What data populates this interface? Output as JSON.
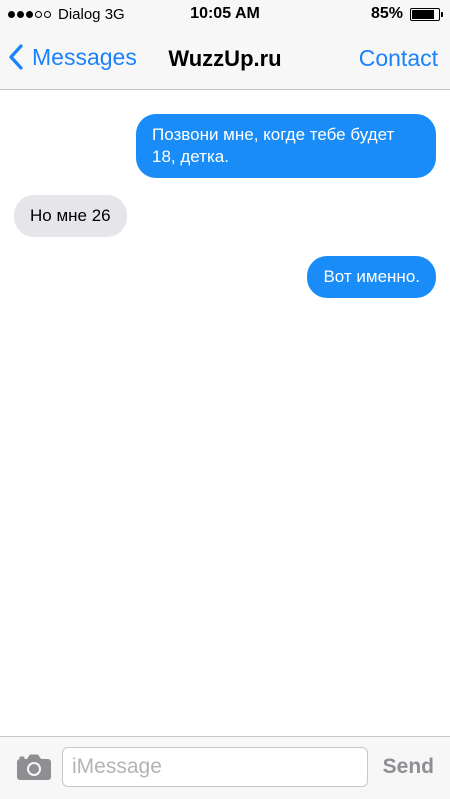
{
  "status_bar": {
    "signal_filled": 3,
    "signal_total": 5,
    "carrier": "Dialog 3G",
    "time": "10:05 AM",
    "battery_percent_label": "85%",
    "battery_level": 0.85
  },
  "nav": {
    "back_label": "Messages",
    "title": "WuzzUp.ru",
    "contact_label": "Contact",
    "accent_color": "#1a82fb"
  },
  "messages": [
    {
      "direction": "outgoing",
      "text": "Позвони мне, когде тебе будет 18, детка."
    },
    {
      "direction": "incoming",
      "text": "Но мне 26"
    },
    {
      "direction": "outgoing",
      "text": "Вот именно."
    }
  ],
  "colors": {
    "outgoing_bubble": "#1a8cf8",
    "incoming_bubble": "#e5e5ea"
  },
  "input_bar": {
    "camera_icon": "camera-icon",
    "placeholder": "iMessage",
    "value": "",
    "send_label": "Send"
  }
}
